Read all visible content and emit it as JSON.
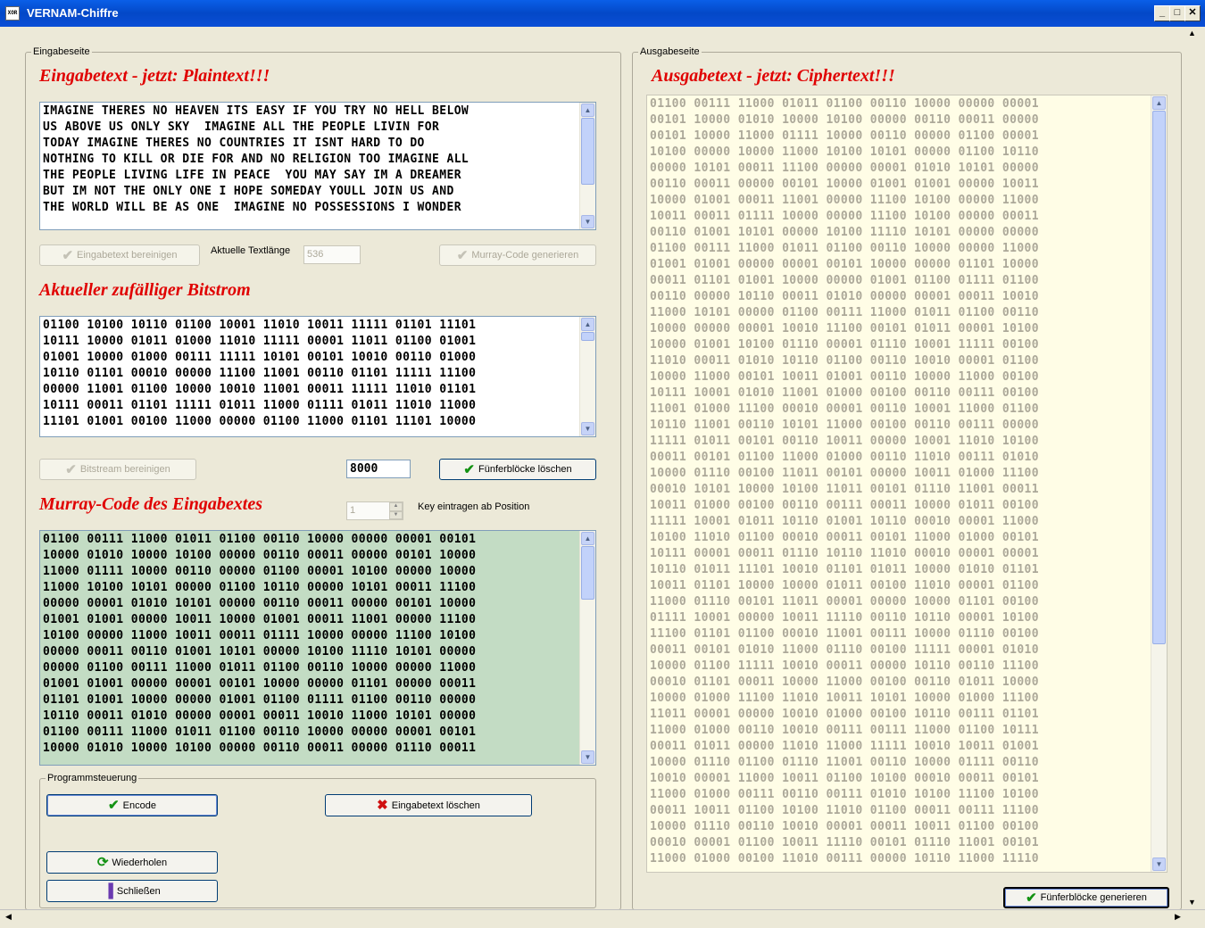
{
  "window": {
    "title": "VERNAM-Chiffre",
    "icon_text": "XOR"
  },
  "input_page": {
    "legend": "Eingabeseite",
    "plaintext_heading": "Eingabetext - jetzt: Plaintext!!!",
    "plaintext_lines": [
      "IMAGINE THERES NO HEAVEN ITS EASY IF YOU TRY NO HELL BELOW",
      "US ABOVE US ONLY SKY  IMAGINE ALL THE PEOPLE LIVIN FOR",
      "TODAY IMAGINE THERES NO COUNTRIES IT ISNT HARD TO DO",
      "NOTHING TO KILL OR DIE FOR AND NO RELIGION TOO IMAGINE ALL",
      "THE PEOPLE LIVING LIFE IN PEACE  YOU MAY SAY IM A DREAMER",
      "BUT IM NOT THE ONLY ONE I HOPE SOMEDAY YOULL JOIN US AND",
      "THE WORLD WILL BE AS ONE  IMAGINE NO POSSESSIONS I WONDER"
    ],
    "clean_text_button": "Eingabetext bereinigen",
    "text_length_label": "Aktuelle Textlänge",
    "text_length_value": "536",
    "murray_generate_button": "Murray-Code generieren",
    "bitstream_heading": "Aktueller zufälliger Bitstrom",
    "bitstream_lines": [
      "01100 10100 10110 01100 10001 11010 10011 11111 01101 11101",
      "10111 10000 01011 01000 11010 11111 00001 11011 01100 01001",
      "01001 10000 01000 00111 11111 10101 00101 10010 00110 01000",
      "10110 01101 00010 00000 11100 11001 00110 01101 11111 11100",
      "00000 11001 01100 10000 10010 11001 00011 11111 11010 01101",
      "10111 00011 01101 11111 01011 11000 01111 01011 11010 11000",
      "11101 01001 00100 11000 00000 01100 11000 01101 11101 10000"
    ],
    "clean_bitstream_button": "Bitstream bereinigen",
    "bitstream_length_value": "8000",
    "delete_blocks_button": "Fünferblöcke löschen",
    "murray_heading": "Murray-Code des Eingabextes",
    "key_position_value": "1",
    "key_position_label": "Key eintragen ab Position",
    "murray_lines": [
      "01100 00111 11000 01011 01100 00110 10000 00000 00001 00101",
      "10000 01010 10000 10100 00000 00110 00011 00000 00101 10000",
      "11000 01111 10000 00110 00000 01100 00001 10100 00000 10000",
      "11000 10100 10101 00000 01100 10110 00000 10101 00011 11100",
      "00000 00001 01010 10101 00000 00110 00011 00000 00101 10000",
      "01001 01001 00000 10011 10000 01001 00011 11001 00000 11100",
      "10100 00000 11000 10011 00011 01111 10000 00000 11100 10100",
      "00000 00011 00110 01001 10101 00000 10100 11110 10101 00000",
      "00000 01100 00111 11000 01011 01100 00110 10000 00000 11000",
      "01001 01001 00000 00001 00101 10000 00000 01101 00000 00011",
      "01101 01001 10000 00000 01001 01100 01111 01100 00110 00000",
      "10110 00011 01010 00000 00001 00011 10010 11000 10101 00000",
      "01100 00111 11000 01011 01100 00110 10000 00000 00001 00101",
      "10000 01010 10000 10100 00000 00110 00011 00000 01110 00011"
    ],
    "control_legend": "Programmsteuerung",
    "encode_button": "Encode",
    "delete_input_button": "Eingabetext löschen",
    "repeat_button": "Wiederholen",
    "close_button": "Schließen"
  },
  "output_page": {
    "legend": "Ausgabeseite",
    "ciphertext_heading": "Ausgabetext - jetzt: Ciphertext!!!",
    "ciphertext_lines": [
      "01100 00111 11000 01011 01100 00110 10000 00000 00001",
      "00101 10000 01010 10000 10100 00000 00110 00011 00000",
      "00101 10000 11000 01111 10000 00110 00000 01100 00001",
      "10100 00000 10000 11000 10100 10101 00000 01100 10110",
      "00000 10101 00011 11100 00000 00001 01010 10101 00000",
      "00110 00011 00000 00101 10000 01001 01001 00000 10011",
      "10000 01001 00011 11001 00000 11100 10100 00000 11000",
      "10011 00011 01111 10000 00000 11100 10100 00000 00011",
      "00110 01001 10101 00000 10100 11110 10101 00000 00000",
      "01100 00111 11000 01011 01100 00110 10000 00000 11000",
      "01001 01001 00000 00001 00101 10000 00000 01101 10000",
      "00011 01101 01001 10000 00000 01001 01100 01111 01100",
      "00110 00000 10110 00011 01010 00000 00001 00011 10010",
      "11000 10101 00000 01100 00111 11000 01011 01100 00110",
      "10000 00000 00001 10010 11100 00101 01011 00001 10100",
      "10000 01001 10100 01110 00001 01110 10001 11111 00100",
      "11010 00011 01010 10110 01100 00110 10010 00001 01100",
      "10000 11000 00101 10011 01001 00110 10000 11000 00100",
      "10111 10001 01010 11001 01000 00100 00110 00111 00100",
      "11001 01000 11100 00010 00001 00110 10001 11000 01100",
      "10110 11001 00110 10101 11000 00100 00110 00111 00000",
      "11111 01011 00101 00110 10011 00000 10001 11010 10100",
      "00011 00101 01100 11000 01000 00110 11010 00111 01010",
      "10000 01110 00100 11011 00101 00000 10011 01000 11100",
      "00010 10101 10000 10100 11011 00101 01110 11001 00011",
      "10011 01000 00100 00110 00111 00011 10000 01011 00100",
      "11111 10001 01011 10110 01001 10110 00010 00001 11000",
      "10100 11010 01100 00010 00011 00101 11000 01000 00101",
      "10111 00001 00011 01110 10110 11010 00010 00001 00001",
      "10110 01011 11101 10010 01101 01011 10000 01010 01101",
      "10011 01101 10000 10000 01011 00100 11010 00001 01100",
      "11000 01110 00101 11011 00001 00000 10000 01101 00100",
      "01111 10001 00000 10011 11110 00110 10110 00001 10100",
      "11100 01101 01100 00010 11001 00111 10000 01110 00100",
      "00011 00101 01010 11000 01110 00100 11111 00001 01010",
      "10000 01100 11111 10010 00011 00000 10110 00110 11100",
      "00010 01101 00011 10000 11000 00100 00110 01011 10000",
      "10000 01000 11100 11010 10011 10101 10000 01000 11100",
      "11011 00001 00000 10010 01000 00100 10110 00111 01101",
      "11000 01000 00110 10010 00111 00111 11000 01100 10111",
      "00011 01011 00000 11010 11000 11111 10010 10011 01001",
      "10000 01110 01100 01110 11001 00110 10000 01111 00110",
      "10010 00001 11000 10011 01100 10100 00010 00011 00101",
      "11000 01000 00111 00110 00111 01010 10100 11100 10100",
      "00011 10011 01100 10100 11010 01100 00011 00111 11100",
      "10000 01110 00110 10010 00001 00011 10011 01100 00100",
      "00010 00001 01100 10011 11110 00101 01110 11001 00101",
      "11000 01000 00100 11010 00111 00000 10110 11000 11110"
    ],
    "generate_blocks_button": "Fünferblöcke generieren"
  },
  "icons": {
    "check": "✔",
    "cross": "✖",
    "repeat": "⟳",
    "exit": "▐"
  }
}
